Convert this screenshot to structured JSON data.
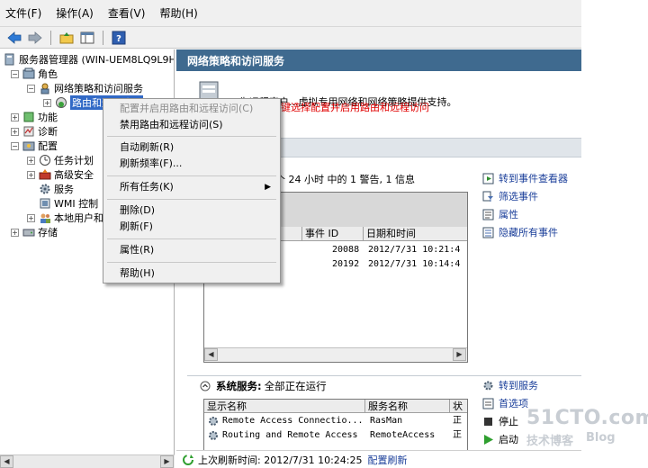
{
  "menubar": {
    "items": [
      "文件(F)",
      "操作(A)",
      "查看(V)",
      "帮助(H)"
    ]
  },
  "tree": {
    "root_label": "服务器管理器 (WIN-UEM8LQ9L9H",
    "items": [
      "角色",
      "网络策略和访问服务",
      "路由和远程访问",
      "功能",
      "诊断",
      "配置",
      "任务计划",
      "高级安全",
      "服务",
      "WMI 控制",
      "本地用户和",
      "存储"
    ]
  },
  "main": {
    "header": "网络策略和访问服务",
    "summary_text": "为远程客户...虚拟专用网络和网络策略提供支持。",
    "annotation": "右键选择配置并启用路由和远程访问",
    "events_summary": "个 24 小时 中的 1 警告, 1 信息",
    "event_columns": [
      "事件 ID",
      "日期和时间"
    ],
    "events": [
      {
        "id": "20088",
        "datetime": "2012/7/31 10:21:4"
      },
      {
        "id": "20192",
        "datetime": "2012/7/31 10:14:4"
      }
    ],
    "event_actions": [
      "转到事件查看器",
      "筛选事件",
      "属性",
      "隐藏所有事件"
    ],
    "services_title_label": "系统服务:",
    "services_title_value": "全部正在运行",
    "service_columns": [
      "显示名称",
      "服务名称",
      "状"
    ],
    "services": [
      {
        "display": "Remote Access Connectio...",
        "name": "RasMan",
        "status": "正"
      },
      {
        "display": "Routing and Remote Access",
        "name": "RemoteAccess",
        "status": "正"
      }
    ],
    "service_actions": [
      "转到服务",
      "首选项",
      "停止",
      "启动"
    ]
  },
  "statusbar": {
    "text": "上次刷新时间: 2012/7/31 10:24:25",
    "link": "配置刷新"
  },
  "context_menu": {
    "items": [
      {
        "label": "配置并启用路由和远程访问(C)",
        "disabled": true
      },
      {
        "label": "禁用路由和远程访问(S)",
        "disabled": false
      },
      {
        "label": "自动刷新(R)",
        "disabled": false
      },
      {
        "label": "刷新频率(F)...",
        "disabled": false
      },
      {
        "label": "所有任务(K)",
        "disabled": false
      },
      {
        "label": "删除(D)",
        "disabled": false
      },
      {
        "label": "刷新(F)",
        "disabled": false
      },
      {
        "label": "属性(R)",
        "disabled": false
      },
      {
        "label": "帮助(H)",
        "disabled": false
      }
    ]
  },
  "watermark": {
    "line1": "51CTO.com",
    "line2": "技术博客",
    "line3": "Blog"
  },
  "colors": {
    "header_bg": "#3f6a8f",
    "link": "#1b3f9a",
    "annotation": "#e00000"
  }
}
